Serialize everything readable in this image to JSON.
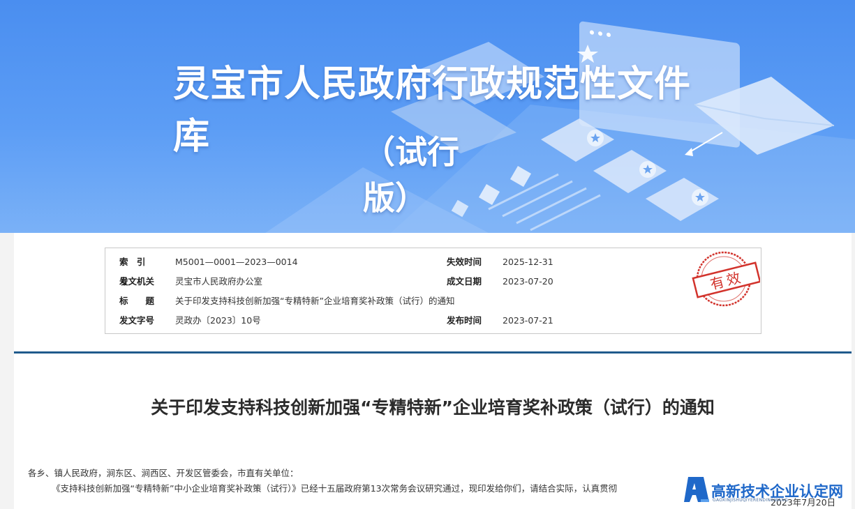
{
  "banner": {
    "title_line1": "灵宝市人民政府行政规范性文件库",
    "title_line2": "（试行版）"
  },
  "info": {
    "index_label": "索 引 号",
    "index_value": "M5001—0001—2023—0014",
    "issuer_label": "发文机关",
    "issuer_value": "灵宝市人民政府办公室",
    "title_label": "标　　题",
    "title_value": "关于印发支持科技创新加强“专精特新”企业培育奖补政策（试行）的通知",
    "docno_label": "发文字号",
    "docno_value": "灵政办〔2023〕10号",
    "expire_label": "失效时间",
    "expire_value": "2025-12-31",
    "made_label": "成文日期",
    "made_value": "2023-07-20",
    "publish_label": "发布时间",
    "publish_value": "2023-07-21",
    "stamp_text": "有效",
    "stamp_color": "#d2332c"
  },
  "document": {
    "title": "关于印发支持科技创新加强“专精特新”企业培育奖补政策（试行）的通知",
    "salutation": "各乡、镇人民政府，涧东区、涧西区、开发区管委会，市直有关单位：",
    "body": "《支持科技创新加强“专精特新”中小企业培育奖补政策（试行）》已经十五届政府第13次常务会议研究通过，现印发给你们，请结合实际，认真贯彻",
    "date": "2023年7月20日"
  },
  "watermark": {
    "text": "高新技术企业认定网",
    "sub": "GAOXINJISHUQIYERENDINGWANG",
    "color": "#1f68c9"
  },
  "colors": {
    "banner": "#5c9df5",
    "divider": "#1f5a8c"
  }
}
